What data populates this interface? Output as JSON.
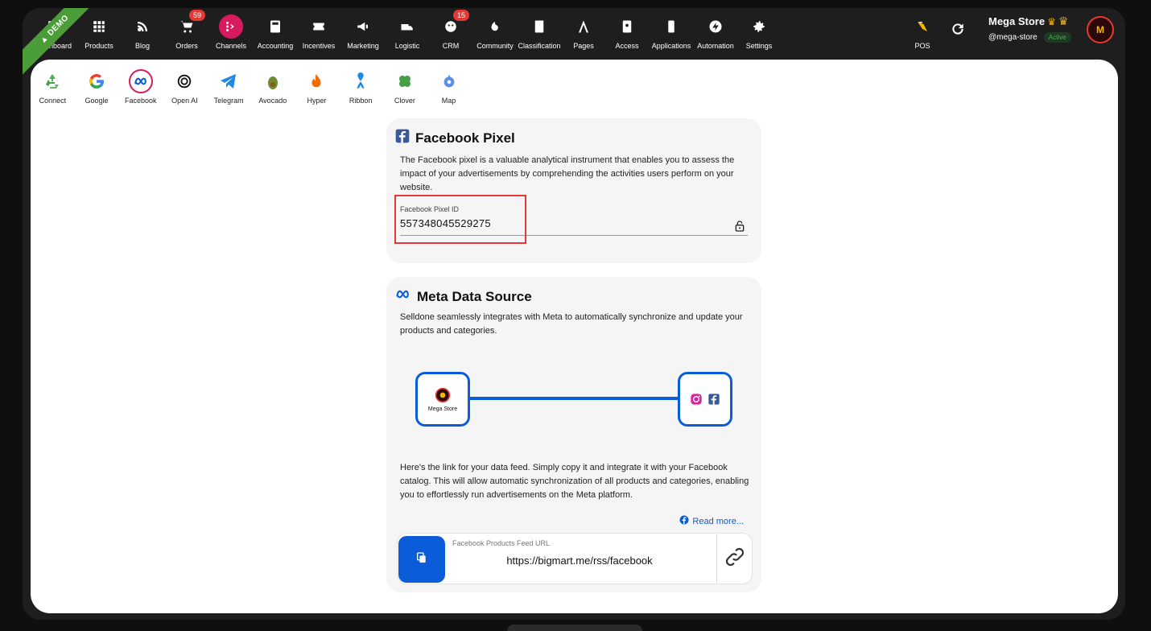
{
  "demo_ribbon": "DEMO",
  "topnav": {
    "items": [
      {
        "label": "Dashboard",
        "icon": "dashboard-icon"
      },
      {
        "label": "Products",
        "icon": "grid-icon"
      },
      {
        "label": "Blog",
        "icon": "blog-icon"
      },
      {
        "label": "Orders",
        "icon": "cart-icon",
        "badge": "59"
      },
      {
        "label": "Channels",
        "icon": "channels-icon"
      },
      {
        "label": "Accounting",
        "icon": "calculator-icon"
      },
      {
        "label": "Incentives",
        "icon": "ticket-icon"
      },
      {
        "label": "Marketing",
        "icon": "megaphone-icon"
      },
      {
        "label": "Logistic",
        "icon": "truck-icon"
      },
      {
        "label": "CRM",
        "icon": "crm-icon",
        "badge": "15"
      },
      {
        "label": "Community",
        "icon": "community-icon"
      },
      {
        "label": "Classification",
        "icon": "book-icon"
      },
      {
        "label": "Pages",
        "icon": "pages-icon"
      },
      {
        "label": "Access",
        "icon": "access-icon"
      },
      {
        "label": "Applications",
        "icon": "phone-icon"
      },
      {
        "label": "Automation",
        "icon": "bolt-icon"
      },
      {
        "label": "Settings",
        "icon": "gear-icon"
      }
    ],
    "pos_label": "POS"
  },
  "store": {
    "name": "Mega Store",
    "handle": "@mega-store",
    "status": "Active"
  },
  "subnav": {
    "items": [
      {
        "label": "Connect"
      },
      {
        "label": "Google"
      },
      {
        "label": "Facebook"
      },
      {
        "label": "Open AI"
      },
      {
        "label": "Telegram"
      },
      {
        "label": "Avocado"
      },
      {
        "label": "Hyper"
      },
      {
        "label": "Ribbon"
      },
      {
        "label": "Clover"
      },
      {
        "label": "Map"
      }
    ]
  },
  "pixel_card": {
    "title": "Facebook Pixel",
    "description": "The Facebook pixel is a valuable analytical instrument that enables you to assess the impact of your advertisements by comprehending the activities users perform on your website.",
    "field_label": "Facebook Pixel ID",
    "field_value": "557348045529275"
  },
  "meta_card": {
    "title": "Meta Data Source",
    "description": "Selldone seamlessly integrates with Meta to automatically synchronize and update your products and categories.",
    "node_store_label": "Mega Store",
    "feed_description": "Here's the link for your data feed. Simply copy it and integrate it with your Facebook catalog. This will allow automatic synchronization of all products and categories, enabling you to effortlessly run advertisements on the Meta platform.",
    "read_more": "Read more...",
    "url_label": "Facebook Products Feed URL",
    "url_value": "https://bigmart.me/rss/facebook"
  },
  "colors": {
    "accent": "#0b5cd8",
    "active_channel": "#d81b60",
    "highlight": "#e53935"
  }
}
